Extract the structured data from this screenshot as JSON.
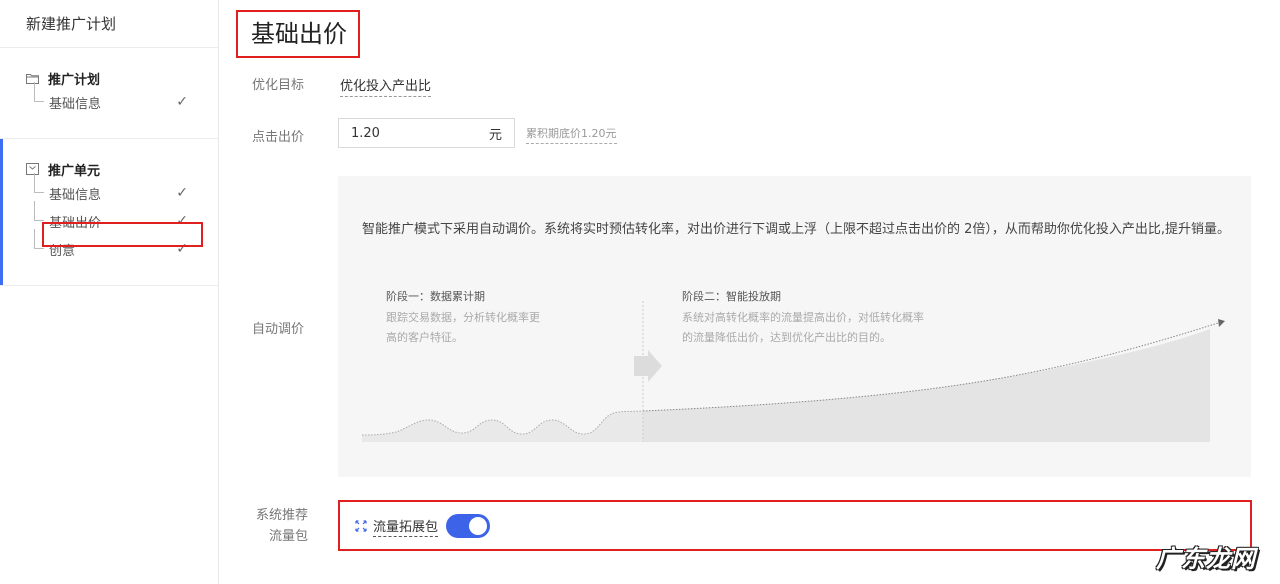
{
  "sidebar": {
    "title": "新建推广计划",
    "group1": {
      "label": "推广计划",
      "icon": "folder-icon",
      "items": [
        {
          "label": "基础信息",
          "done": true
        }
      ]
    },
    "group2": {
      "label": "推广单元",
      "icon": "unit-box-icon",
      "items": [
        {
          "label": "基础信息",
          "done": true
        },
        {
          "label": "基础出价",
          "done": true,
          "highlighted": true
        },
        {
          "label": "创意",
          "done": true
        }
      ]
    },
    "check_glyph": "✓"
  },
  "main": {
    "page_title": "基础出价",
    "opt_target": {
      "label": "优化目标",
      "value": "优化投入产出比"
    },
    "click_bid": {
      "label": "点击出价",
      "value": "1.20",
      "unit": "元",
      "note": "累积期底价1.20元"
    },
    "auto_bid": {
      "label": "自动调价",
      "description": "智能推广模式下采用自动调价。系统将实时预估转化率，对出价进行下调或上浮（上限不超过点击出价的 2倍），从而帮助你优化投入产出比,提升销量。",
      "stage1_title": "阶段一：数据累计期",
      "stage1_desc_1": "跟踪交易数据，分析转化概率更",
      "stage1_desc_2": "高的客户特征。",
      "stage2_title": "阶段二：智能投放期",
      "stage2_desc_1": "系统对高转化概率的流量提高出价，对低转化概率",
      "stage2_desc_2": "的流量降低出价，达到优化产出比的目的。"
    },
    "traffic_pkg": {
      "label_line1": "系统推荐",
      "label_line2": "流量包",
      "name": "流量拓展包",
      "icon": "expand-arrows-icon",
      "enabled": true
    }
  },
  "watermark": "广东龙网",
  "colors": {
    "accent": "#3d63e8",
    "highlight": "#e02020"
  }
}
